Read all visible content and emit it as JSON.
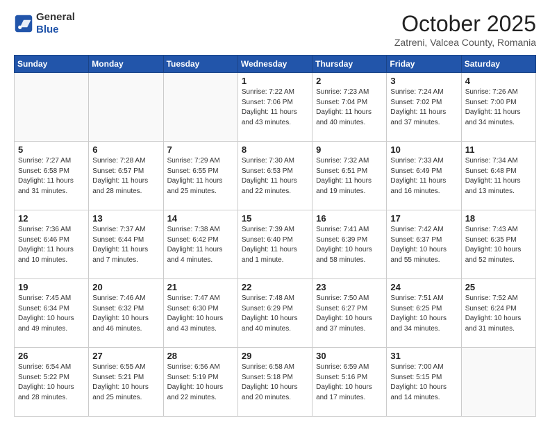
{
  "header": {
    "logo_general": "General",
    "logo_blue": "Blue",
    "title": "October 2025",
    "location": "Zatreni, Valcea County, Romania"
  },
  "days_of_week": [
    "Sunday",
    "Monday",
    "Tuesday",
    "Wednesday",
    "Thursday",
    "Friday",
    "Saturday"
  ],
  "weeks": [
    [
      {
        "day": "",
        "info": ""
      },
      {
        "day": "",
        "info": ""
      },
      {
        "day": "",
        "info": ""
      },
      {
        "day": "1",
        "info": "Sunrise: 7:22 AM\nSunset: 7:06 PM\nDaylight: 11 hours and 43 minutes."
      },
      {
        "day": "2",
        "info": "Sunrise: 7:23 AM\nSunset: 7:04 PM\nDaylight: 11 hours and 40 minutes."
      },
      {
        "day": "3",
        "info": "Sunrise: 7:24 AM\nSunset: 7:02 PM\nDaylight: 11 hours and 37 minutes."
      },
      {
        "day": "4",
        "info": "Sunrise: 7:26 AM\nSunset: 7:00 PM\nDaylight: 11 hours and 34 minutes."
      }
    ],
    [
      {
        "day": "5",
        "info": "Sunrise: 7:27 AM\nSunset: 6:58 PM\nDaylight: 11 hours and 31 minutes."
      },
      {
        "day": "6",
        "info": "Sunrise: 7:28 AM\nSunset: 6:57 PM\nDaylight: 11 hours and 28 minutes."
      },
      {
        "day": "7",
        "info": "Sunrise: 7:29 AM\nSunset: 6:55 PM\nDaylight: 11 hours and 25 minutes."
      },
      {
        "day": "8",
        "info": "Sunrise: 7:30 AM\nSunset: 6:53 PM\nDaylight: 11 hours and 22 minutes."
      },
      {
        "day": "9",
        "info": "Sunrise: 7:32 AM\nSunset: 6:51 PM\nDaylight: 11 hours and 19 minutes."
      },
      {
        "day": "10",
        "info": "Sunrise: 7:33 AM\nSunset: 6:49 PM\nDaylight: 11 hours and 16 minutes."
      },
      {
        "day": "11",
        "info": "Sunrise: 7:34 AM\nSunset: 6:48 PM\nDaylight: 11 hours and 13 minutes."
      }
    ],
    [
      {
        "day": "12",
        "info": "Sunrise: 7:36 AM\nSunset: 6:46 PM\nDaylight: 11 hours and 10 minutes."
      },
      {
        "day": "13",
        "info": "Sunrise: 7:37 AM\nSunset: 6:44 PM\nDaylight: 11 hours and 7 minutes."
      },
      {
        "day": "14",
        "info": "Sunrise: 7:38 AM\nSunset: 6:42 PM\nDaylight: 11 hours and 4 minutes."
      },
      {
        "day": "15",
        "info": "Sunrise: 7:39 AM\nSunset: 6:40 PM\nDaylight: 11 hours and 1 minute."
      },
      {
        "day": "16",
        "info": "Sunrise: 7:41 AM\nSunset: 6:39 PM\nDaylight: 10 hours and 58 minutes."
      },
      {
        "day": "17",
        "info": "Sunrise: 7:42 AM\nSunset: 6:37 PM\nDaylight: 10 hours and 55 minutes."
      },
      {
        "day": "18",
        "info": "Sunrise: 7:43 AM\nSunset: 6:35 PM\nDaylight: 10 hours and 52 minutes."
      }
    ],
    [
      {
        "day": "19",
        "info": "Sunrise: 7:45 AM\nSunset: 6:34 PM\nDaylight: 10 hours and 49 minutes."
      },
      {
        "day": "20",
        "info": "Sunrise: 7:46 AM\nSunset: 6:32 PM\nDaylight: 10 hours and 46 minutes."
      },
      {
        "day": "21",
        "info": "Sunrise: 7:47 AM\nSunset: 6:30 PM\nDaylight: 10 hours and 43 minutes."
      },
      {
        "day": "22",
        "info": "Sunrise: 7:48 AM\nSunset: 6:29 PM\nDaylight: 10 hours and 40 minutes."
      },
      {
        "day": "23",
        "info": "Sunrise: 7:50 AM\nSunset: 6:27 PM\nDaylight: 10 hours and 37 minutes."
      },
      {
        "day": "24",
        "info": "Sunrise: 7:51 AM\nSunset: 6:25 PM\nDaylight: 10 hours and 34 minutes."
      },
      {
        "day": "25",
        "info": "Sunrise: 7:52 AM\nSunset: 6:24 PM\nDaylight: 10 hours and 31 minutes."
      }
    ],
    [
      {
        "day": "26",
        "info": "Sunrise: 6:54 AM\nSunset: 5:22 PM\nDaylight: 10 hours and 28 minutes."
      },
      {
        "day": "27",
        "info": "Sunrise: 6:55 AM\nSunset: 5:21 PM\nDaylight: 10 hours and 25 minutes."
      },
      {
        "day": "28",
        "info": "Sunrise: 6:56 AM\nSunset: 5:19 PM\nDaylight: 10 hours and 22 minutes."
      },
      {
        "day": "29",
        "info": "Sunrise: 6:58 AM\nSunset: 5:18 PM\nDaylight: 10 hours and 20 minutes."
      },
      {
        "day": "30",
        "info": "Sunrise: 6:59 AM\nSunset: 5:16 PM\nDaylight: 10 hours and 17 minutes."
      },
      {
        "day": "31",
        "info": "Sunrise: 7:00 AM\nSunset: 5:15 PM\nDaylight: 10 hours and 14 minutes."
      },
      {
        "day": "",
        "info": ""
      }
    ]
  ]
}
